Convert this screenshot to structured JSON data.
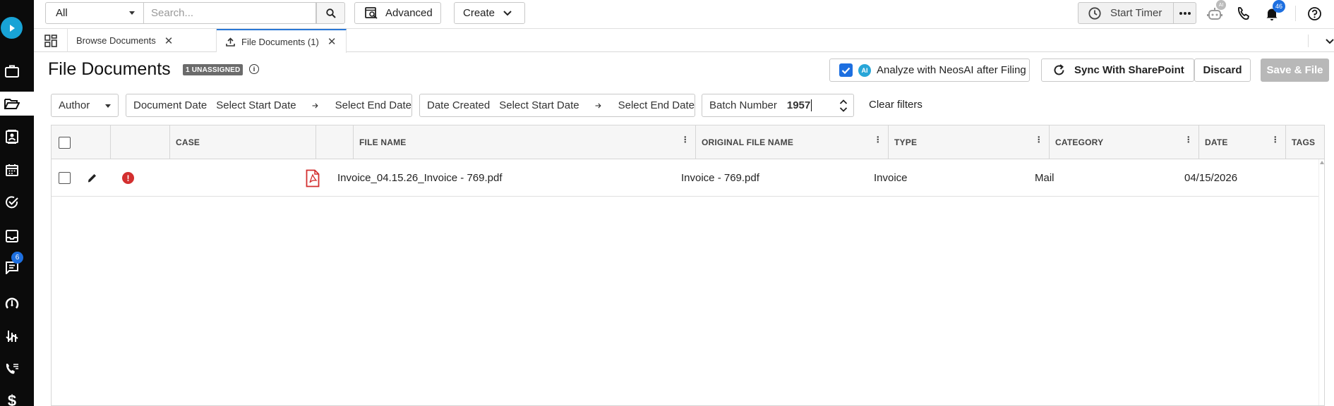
{
  "topbar": {
    "scope_value": "All",
    "search_placeholder": "Search...",
    "advanced_label": "Advanced",
    "create_label": "Create",
    "timer_label": "Start Timer",
    "ai_badge": "AI",
    "notifications_count": "46"
  },
  "rail": {
    "messages_badge": "6"
  },
  "tabs": [
    {
      "label": "Browse Documents"
    },
    {
      "label": "File Documents (1)"
    }
  ],
  "header": {
    "title": "File Documents",
    "unassigned_badge": "1 UNASSIGNED",
    "analyze_label": "Analyze with NeosAI after Filing",
    "ai_chip": "AI",
    "sync_label": "Sync With SharePoint",
    "discard_label": "Discard",
    "save_file_label": "Save & File"
  },
  "filters": {
    "author_label": "Author",
    "document_date_label": "Document Date",
    "date_created_label": "Date Created",
    "start_placeholder": "Select Start Date",
    "end_placeholder": "Select End Date",
    "batch_label": "Batch Number",
    "batch_value": "1957",
    "clear_label": "Clear filters"
  },
  "table": {
    "columns": [
      "CASE",
      "FILE NAME",
      "ORIGINAL FILE NAME",
      "TYPE",
      "CATEGORY",
      "DATE",
      "TAGS"
    ],
    "rows": [
      {
        "case": "",
        "file_name": "Invoice_04.15.26_Invoice - 769.pdf",
        "original_file_name": "Invoice - 769.pdf",
        "type": "Invoice",
        "category": "Mail",
        "date": "04/15/2026",
        "tags": ""
      }
    ]
  },
  "colors": {
    "accent": "#1d6fe0",
    "logo": "#18a3d6",
    "error": "#d32f2f",
    "rail": "#0b0b0b"
  }
}
